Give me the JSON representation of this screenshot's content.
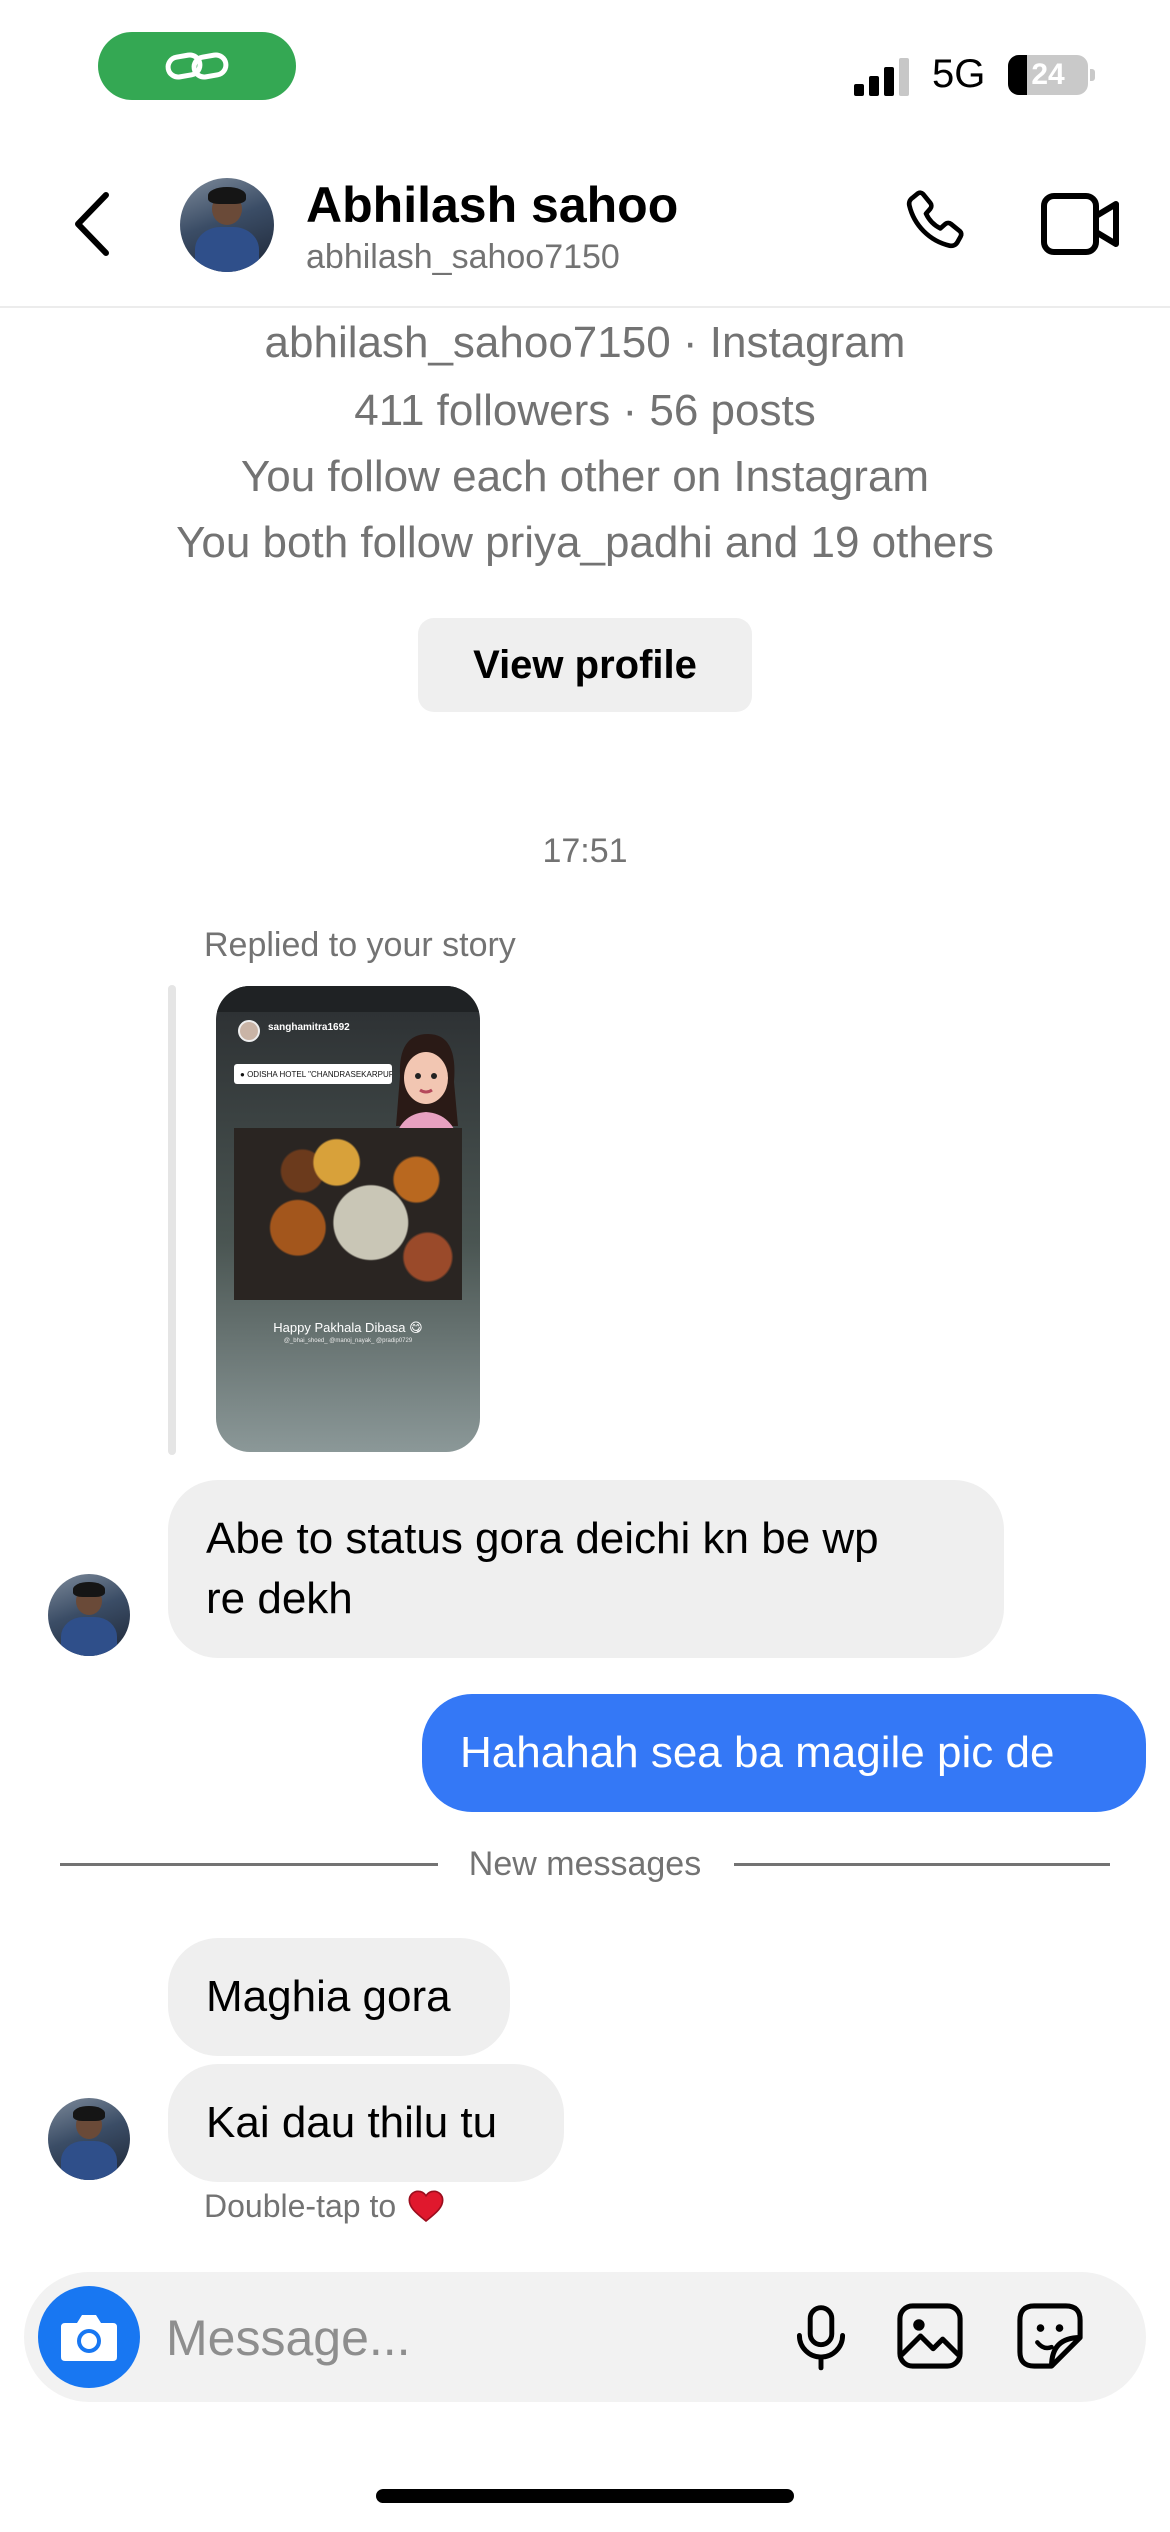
{
  "status_bar": {
    "network": "5G",
    "battery": "24",
    "battery_level": 0.24,
    "link_icon": "link-icon",
    "signal_bars_active": 3,
    "signal_bars_total": 4
  },
  "header": {
    "name": "Abhilash sahoo",
    "username": "abhilash_sahoo7150",
    "back_icon": "chevron-left-icon",
    "call_icon": "phone-icon",
    "video_icon": "video-camera-icon"
  },
  "profile": {
    "line1": "abhilash_sahoo7150 · Instagram",
    "line2": "411 followers · 56 posts",
    "line3": "You follow each other on Instagram",
    "line4": "You both follow priya_padhi and 19 others",
    "view_button": "View profile"
  },
  "chat": {
    "timestamp": "17:51",
    "reply_label": "Replied to your story",
    "story": {
      "username": "sanghamitra1692",
      "location": "ODISHA HOTEL \"CHANDRASEKARPUR\"",
      "caption": "Happy Pakhala Dibasa 😋",
      "tags": "@_bhai_shoed_ @manoj_nayak_ @pradip0729"
    },
    "messages": [
      {
        "from": "them",
        "line1": "Abe to status gora deichi kn be wp",
        "line2": "re dekh"
      },
      {
        "from": "me",
        "text": "Hahahah sea ba magile pic de"
      },
      {
        "from": "them",
        "text": "Maghia gora"
      },
      {
        "from": "them",
        "text": "Kai dau thilu tu"
      }
    ],
    "new_messages_label": "New messages",
    "double_tap": "Double-tap to",
    "heart_icon": "heart-icon"
  },
  "composer": {
    "placeholder": "Message...",
    "camera_icon": "camera-icon",
    "mic_icon": "microphone-icon",
    "gallery_icon": "image-icon",
    "sticker_icon": "sticker-icon"
  },
  "colors": {
    "accent_blue": "#3478f6",
    "camera_blue": "#1877f2",
    "link_green": "#34a853",
    "bubble_gray": "#efefef",
    "secondary_text": "#737373"
  }
}
